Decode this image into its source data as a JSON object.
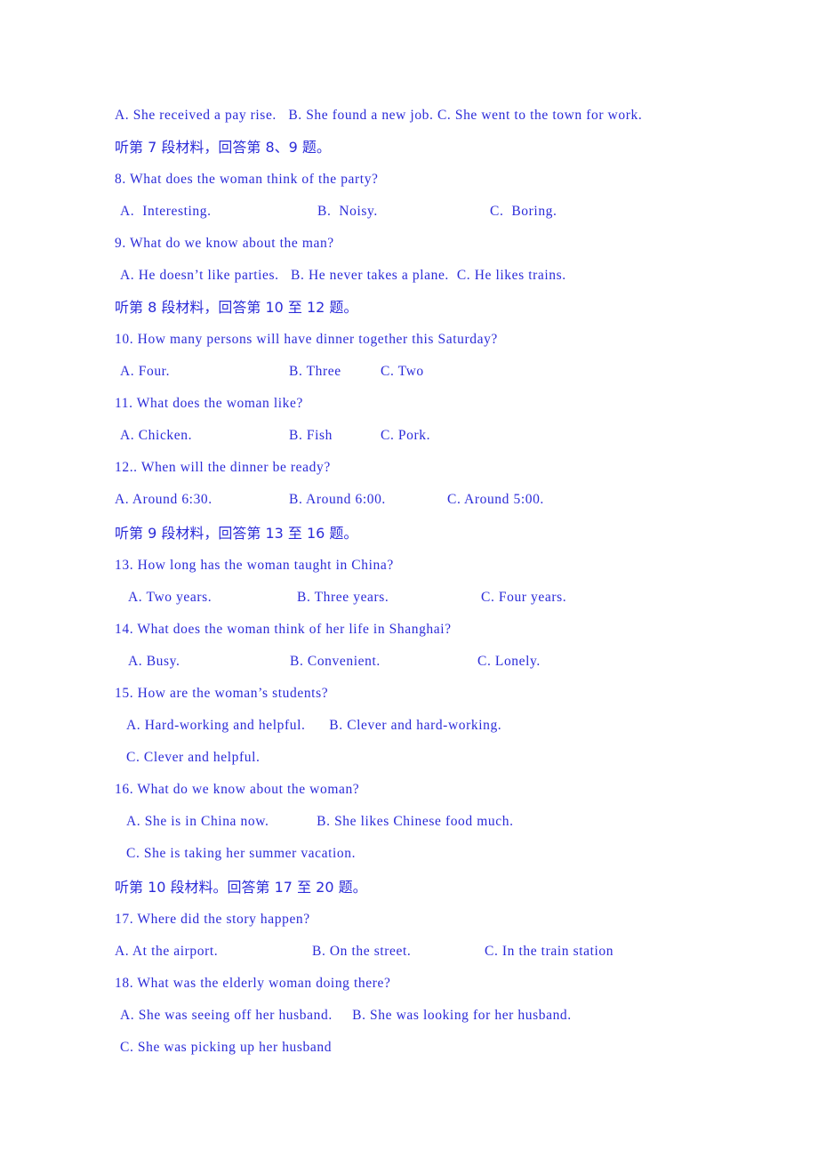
{
  "document": {
    "language_mix": "Chinese-English listening comprehension exam paper",
    "text_color": "#2b2bd8",
    "background_color": "#ffffff"
  },
  "lines": [
    {
      "id": "q7-options",
      "type": "options-inline",
      "text": "A. She received a pay rise.   B. She found a new job. C. She went to the town for work."
    },
    {
      "id": "directive-7",
      "type": "chinese-directive",
      "text": "听第 7 段材料，回答第 8、9 题。"
    },
    {
      "id": "q8-stem",
      "type": "question",
      "text": "8. What does the woman think of the party?"
    },
    {
      "id": "q8-options",
      "type": "options-columns",
      "a": "A.  Interesting.",
      "b": "B.  Noisy.",
      "c": "C.  Boring."
    },
    {
      "id": "q9-stem",
      "type": "question",
      "text": "9. What do we know about the man?"
    },
    {
      "id": "q9-options",
      "type": "options-inline",
      "text": "A. He doesn’t like parties.   B. He never takes a plane.  C. He likes trains."
    },
    {
      "id": "directive-8",
      "type": "chinese-directive",
      "text": "听第 8 段材料，回答第 10 至 12 题。"
    },
    {
      "id": "q10-stem",
      "type": "question",
      "text": "10. How many persons will have dinner together this Saturday?"
    },
    {
      "id": "q10-options",
      "type": "options-columns",
      "a": "A. Four.",
      "b": "B. Three",
      "c": "C. Two"
    },
    {
      "id": "q11-stem",
      "type": "question",
      "text": "11. What does the woman like?"
    },
    {
      "id": "q11-options",
      "type": "options-columns",
      "a": "A. Chicken.",
      "b": "B. Fish",
      "c": "C. Pork."
    },
    {
      "id": "q12-stem",
      "type": "question",
      "text": "12.. When will the dinner be ready?"
    },
    {
      "id": "q12-options",
      "type": "options-columns",
      "a": "A. Around 6:30.",
      "b": "B. Around 6:00.",
      "c": "C. Around 5:00."
    },
    {
      "id": "directive-9",
      "type": "chinese-directive",
      "text": "听第 9 段材料，回答第 13 至 16 题。"
    },
    {
      "id": "q13-stem",
      "type": "question",
      "text": "13. How long has the woman taught in China?"
    },
    {
      "id": "q13-options",
      "type": "options-columns",
      "a": "A. Two years.",
      "b": "B. Three years.",
      "c": "C. Four years."
    },
    {
      "id": "q14-stem",
      "type": "question",
      "text": "14. What does the woman think of her life in Shanghai?"
    },
    {
      "id": "q14-options",
      "type": "options-columns",
      "a": "A. Busy.",
      "b": "B. Convenient.",
      "c": "C. Lonely."
    },
    {
      "id": "q15-stem",
      "type": "question",
      "text": "15. How are the woman’s students?"
    },
    {
      "id": "q15-options-ab",
      "type": "options-inline",
      "text": "A. Hard-working and helpful.      B. Clever and hard-working."
    },
    {
      "id": "q15-options-c",
      "type": "options-inline",
      "text": "C. Clever and helpful."
    },
    {
      "id": "q16-stem",
      "type": "question",
      "text": "16. What do we know about the woman?"
    },
    {
      "id": "q16-options-ab",
      "type": "options-inline",
      "text": "A. She is in China now.            B. She likes Chinese food much."
    },
    {
      "id": "q16-options-c",
      "type": "options-inline",
      "text": "C. She is taking her summer vacation."
    },
    {
      "id": "directive-10",
      "type": "chinese-directive",
      "text": "听第 10 段材料。回答第 17 至 20 题。"
    },
    {
      "id": "q17-stem",
      "type": "question",
      "text": "17. Where did the story happen?"
    },
    {
      "id": "q17-options",
      "type": "options-columns",
      "a": "A. At the airport.",
      "b": "B. On the street.",
      "c": "C. In the train station"
    },
    {
      "id": "q18-stem",
      "type": "question",
      "text": "18. What was the elderly woman doing there?"
    },
    {
      "id": "q18-options-ab",
      "type": "options-inline",
      "text": "A. She was seeing off her husband.     B. She was looking for her husband."
    },
    {
      "id": "q18-options-c",
      "type": "options-inline",
      "text": "C. She was picking up her husband"
    }
  ],
  "column_stops": {
    "a": "0px",
    "b": "215px",
    "c": "410px"
  }
}
